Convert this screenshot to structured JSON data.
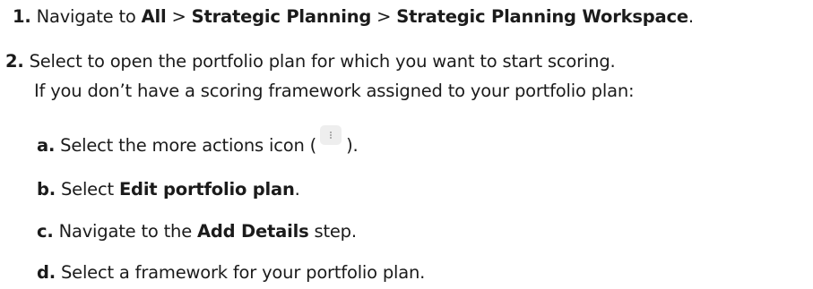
{
  "steps": [
    {
      "number": "1.",
      "segments": [
        {
          "text": " Navigate to ",
          "bold": false
        },
        {
          "text": "All",
          "bold": true
        },
        {
          "text": " > ",
          "bold": false
        },
        {
          "text": "Strategic Planning",
          "bold": true
        },
        {
          "text": " > ",
          "bold": false
        },
        {
          "text": "Strategic Planning Workspace",
          "bold": true
        },
        {
          "text": ".",
          "bold": false
        }
      ]
    },
    {
      "number": "2.",
      "line1": " Select to open the portfolio plan for which you want to start scoring.",
      "line2": "If you don’t have a scoring framework assigned to your portfolio plan:"
    }
  ],
  "substeps": [
    {
      "letter": "a.",
      "before": " Select the more actions icon (",
      "icon": "more-actions-icon",
      "after": ")."
    },
    {
      "letter": "b.",
      "before": " Select ",
      "bold": "Edit portfolio plan",
      "after": "."
    },
    {
      "letter": "c.",
      "before": " Navigate to the ",
      "bold": "Add Details",
      "after": " step."
    },
    {
      "letter": "d.",
      "text": " Select a framework for your portfolio plan."
    }
  ]
}
